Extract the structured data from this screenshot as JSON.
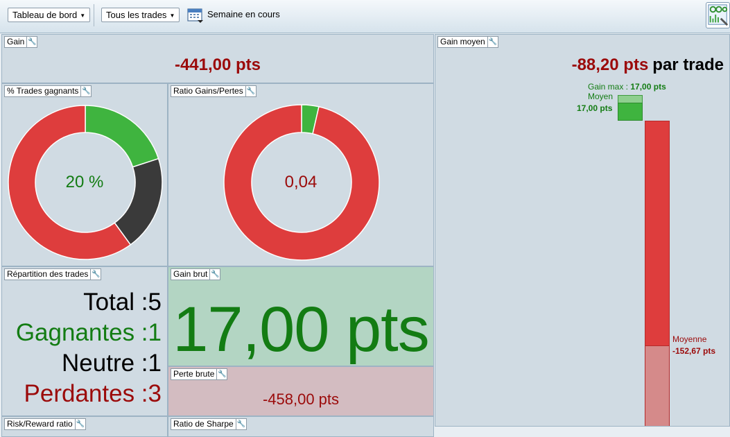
{
  "toolbar": {
    "dashboard_label": "Tableau de bord",
    "trades_filter_label": "Tous les trades",
    "period_label": "Semaine en cours"
  },
  "panels": {
    "gain": {
      "title": "Gain",
      "value": "-441,00 pts"
    },
    "avg_gain": {
      "title": "Gain moyen",
      "value": "-88,20 pts",
      "suffix": "par trade",
      "max_label": "Gain max :",
      "max_value": "17,00 pts",
      "win_avg_label": "Moyen",
      "win_avg_value": "17,00 pts",
      "loss_avg_label": "Moyenne",
      "loss_avg_value": "-152,67 pts"
    },
    "win_rate": {
      "title": "% Trades gagnants",
      "value": "20 %"
    },
    "ratio": {
      "title": "Ratio Gains/Pertes",
      "value": "0,04"
    },
    "distribution": {
      "title": "Répartition des trades",
      "total_label": "Total :",
      "total": "5",
      "winners_label": "Gagnantes :",
      "winners": "1",
      "neutral_label": "Neutre :",
      "neutral": "1",
      "losers_label": "Perdantes :",
      "losers": "3"
    },
    "gross_gain": {
      "title": "Gain brut",
      "value": "17,00 pts"
    },
    "gross_loss": {
      "title": "Perte brute",
      "value": "-458,00 pts"
    },
    "risk_reward": {
      "title": "Risk/Reward ratio"
    },
    "sharpe": {
      "title": "Ratio de Sharpe"
    }
  },
  "chart_data": [
    {
      "type": "pie",
      "title": "% Trades gagnants",
      "categories": [
        "Gagnantes",
        "Neutre",
        "Perdantes"
      ],
      "values": [
        1,
        1,
        3
      ],
      "colors": [
        "#3fb43f",
        "#3a3a3a",
        "#de3d3d"
      ],
      "center_label": "20 %"
    },
    {
      "type": "pie",
      "title": "Ratio Gains/Pertes",
      "categories": [
        "Gains",
        "Pertes"
      ],
      "values": [
        17,
        458
      ],
      "colors": [
        "#3fb43f",
        "#de3d3d"
      ],
      "center_label": "0,04"
    },
    {
      "type": "bar",
      "title": "Gain moyen",
      "categories": [
        "Gagnantes",
        "Perdantes"
      ],
      "values": [
        17,
        -458
      ],
      "averages": [
        17,
        -152.67
      ],
      "colors": [
        "#3fb43f",
        "#de3d3d"
      ]
    }
  ]
}
